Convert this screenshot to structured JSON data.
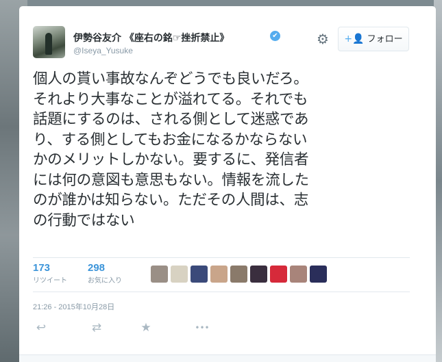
{
  "user": {
    "name": "伊勢谷友介 《座右の銘☞挫折禁止》",
    "handle": "@Iseya_Yusuke",
    "verified_mark": "✔"
  },
  "header": {
    "gear_icon": "⚙",
    "follow_icon": "+👤",
    "follow_label": "フォロー"
  },
  "tweet": {
    "lines": [
      "個人の貰い事故なんぞどうでも良いだろ。",
      "それより大事なことが溢れてる。それでも",
      "話題にするのは、される側として迷惑であ",
      "り、する側としてもお金になるかならない",
      "かのメリットしかない。要するに、発信者",
      "には何の意図も意思もない。情報を流した",
      "のが誰かは知らない。ただその人間は、志",
      "の行動ではない"
    ]
  },
  "stats": {
    "retweets": {
      "count": "173",
      "label": "リツイート"
    },
    "likes": {
      "count": "298",
      "label": "お気に入り"
    }
  },
  "liker_avatars": [
    {
      "name": "liker-avatar-1",
      "color": "#9a8f86"
    },
    {
      "name": "liker-avatar-2",
      "color": "#d8d2c2"
    },
    {
      "name": "liker-avatar-3",
      "color": "#3b4a7a"
    },
    {
      "name": "liker-avatar-4",
      "color": "#c9a58a"
    },
    {
      "name": "liker-avatar-5",
      "color": "#8a7a6a"
    },
    {
      "name": "liker-avatar-6",
      "color": "#3a2e3e"
    },
    {
      "name": "liker-avatar-7",
      "color": "#d62a3a"
    },
    {
      "name": "liker-avatar-8",
      "color": "#a8847a"
    },
    {
      "name": "liker-avatar-9",
      "color": "#2a2e5a"
    }
  ],
  "timestamp": "21:26 - 2015年10月28日",
  "actions": {
    "reply_icon": "↩",
    "retweet_icon": "⇄",
    "favorite_icon": "★",
    "more_icon": "•••"
  },
  "colors": {
    "link": "#3b94d9",
    "text": "#292f33",
    "muted": "#8899a6",
    "verified": "#55acee"
  }
}
